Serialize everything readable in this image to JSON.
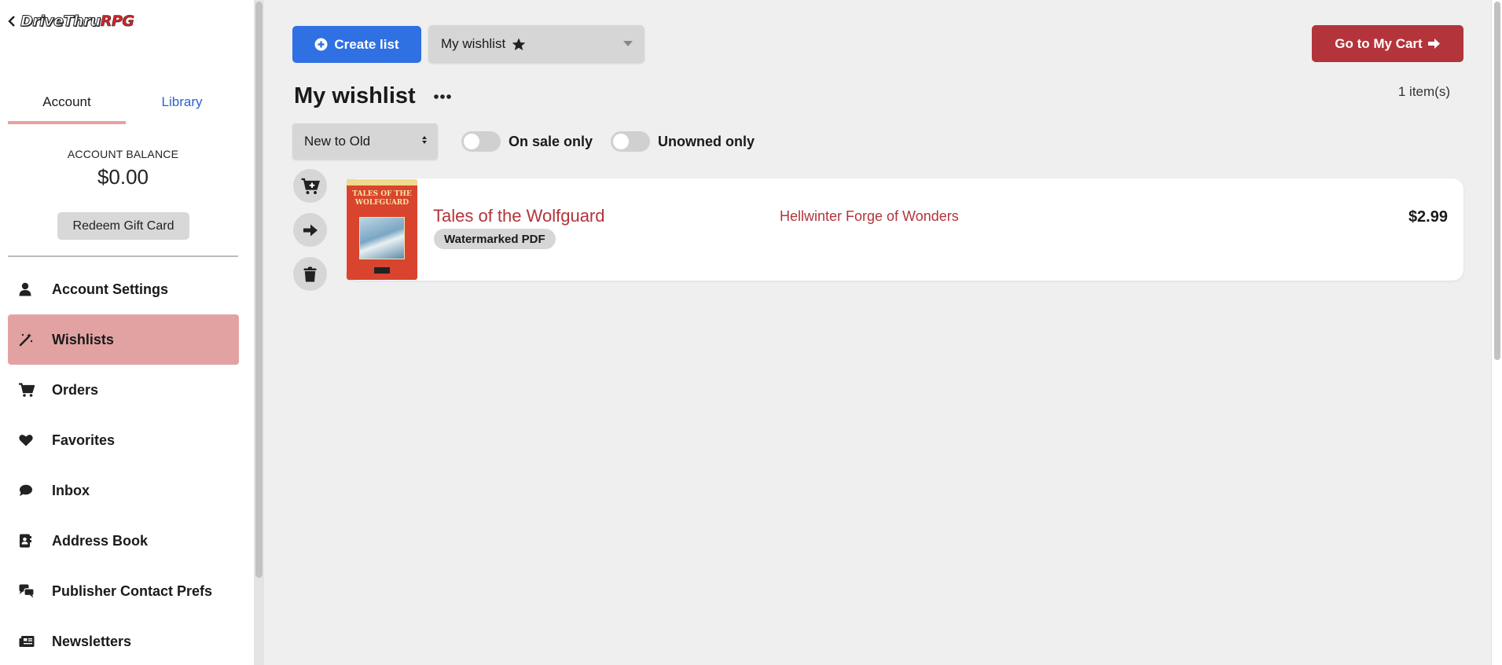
{
  "brand": {
    "logo_part1": "DriveThru",
    "logo_part2": "RPG"
  },
  "sidebar": {
    "tabs": [
      {
        "label": "Account"
      },
      {
        "label": "Library"
      }
    ],
    "balance": {
      "label": "ACCOUNT BALANCE",
      "value": "$0.00"
    },
    "redeem_label": "Redeem Gift Card",
    "items": [
      {
        "label": "Account Settings",
        "icon": "user-icon"
      },
      {
        "label": "Wishlists",
        "icon": "magic-wand-icon",
        "active": true
      },
      {
        "label": "Orders",
        "icon": "cart-icon"
      },
      {
        "label": "Favorites",
        "icon": "heart-icon"
      },
      {
        "label": "Inbox",
        "icon": "chat-bubble-icon"
      },
      {
        "label": "Address Book",
        "icon": "address-book-icon"
      },
      {
        "label": "Publisher Contact Prefs",
        "icon": "comments-icon"
      },
      {
        "label": "Newsletters",
        "icon": "newspaper-icon"
      }
    ]
  },
  "toolbar": {
    "create_label": "Create list",
    "list_select_value": "My wishlist",
    "cart_label": "Go to My Cart"
  },
  "list": {
    "title": "My wishlist",
    "item_count": "1 item(s)",
    "sort_value": "New to Old",
    "filters": [
      {
        "label": "On sale only",
        "on": false
      },
      {
        "label": "Unowned only",
        "on": false
      }
    ]
  },
  "items": [
    {
      "cover_title": "TALES OF THE WOLFGUARD",
      "title": "Tales of the Wolfguard",
      "format": "Watermarked PDF",
      "publisher": "Hellwinter Forge of Wonders",
      "price": "$2.99"
    }
  ],
  "colors": {
    "accent_red": "#b3343a",
    "primary_blue": "#2f70e3",
    "active_nav": "#e3a2a2"
  }
}
